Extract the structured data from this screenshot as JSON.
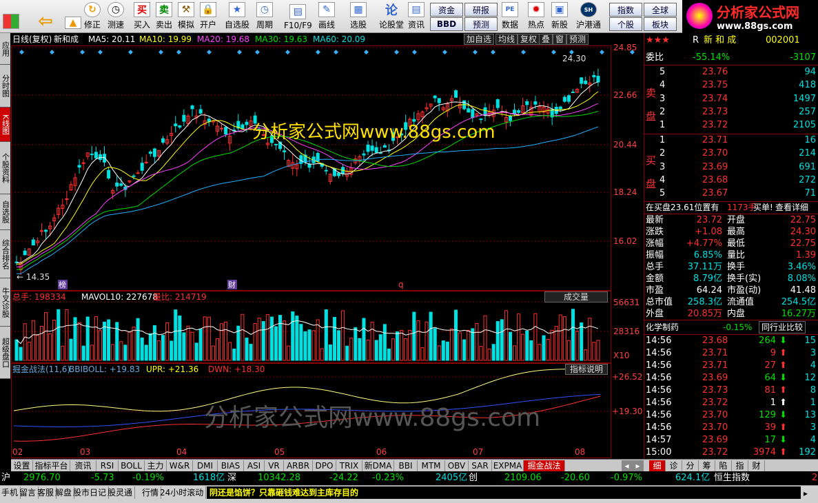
{
  "toolbar": {
    "buttons": [
      {
        "label": ""
      },
      {
        "label": ""
      },
      {
        "label": "修正"
      },
      {
        "label": "测速"
      },
      {
        "label": "买入"
      },
      {
        "label": "卖出"
      },
      {
        "label": "模拟"
      },
      {
        "label": "开户"
      },
      {
        "label": "自选股"
      },
      {
        "label": "周期"
      },
      {
        "label": "F10/F9"
      },
      {
        "label": "画线"
      },
      {
        "label": "选股"
      },
      {
        "label": "论股堂"
      },
      {
        "label": "资讯"
      },
      {
        "label": "数据"
      },
      {
        "label": "热点"
      },
      {
        "label": "新股"
      },
      {
        "label": "沪港通"
      }
    ],
    "small_buttons": [
      "资金",
      "研报",
      "BBD",
      "预测",
      "指数",
      "全球",
      "个股",
      "板块"
    ],
    "logo_title": "分析家公式网",
    "logo_url": "www.88gs.com"
  },
  "left_tabs": [
    "应用",
    "分时图",
    "K线图",
    "个股资料",
    "自选股",
    "综合排名",
    "牛叉诊股",
    "超级盘口"
  ],
  "info_bar": {
    "mode": "日线(复权)",
    "stock_name": "新和成",
    "ma5": "MA5: 20.11",
    "ma10": "MA10: 19.99",
    "ma20": "MA20: 19.68",
    "ma30": "MA30: 19.63",
    "ma60": "MA60: 20.09",
    "buttons": [
      "加自选",
      "均线",
      "复权",
      "叠",
      "窗",
      "预测"
    ]
  },
  "price_axis": [
    "24.85",
    "22.66",
    "20.44",
    "18.24",
    "16.02"
  ],
  "price_labels": {
    "high": "24.30",
    "low": "14.35"
  },
  "markers": [
    "榜",
    "财",
    "q"
  ],
  "watermark_top": "分析家公式网www.88gs.com",
  "watermark_bottom": "分析家公式网www.88gs.com",
  "volume_bar": {
    "total": "总手: 198334",
    "mavol": "MAVOL10: 227678",
    "ratio": "量比: 214719",
    "selector": "成交量",
    "axis": [
      "56631",
      "28316",
      "X10"
    ]
  },
  "indicator_bar": {
    "name": "掘金战法(11,6)",
    "bbiboll": "BBIBOLL: +19.83",
    "upr": "UPR: +21.36",
    "dwn": "DWN: +18.30",
    "help": "指标说明",
    "axis": [
      "+26.52",
      "+19.30"
    ]
  },
  "x_axis": [
    "02",
    "03",
    "04",
    "05",
    "06",
    "07",
    "08"
  ],
  "right_panel": {
    "header": {
      "stars": "★★★",
      "name": "新 和 成",
      "code": "002001",
      "prefix": "R"
    },
    "weibi": {
      "label": "委比",
      "pct": "-55.14%",
      "diff": "-3107"
    },
    "sell_label": "卖盘",
    "buy_label": "买盘",
    "sell": [
      {
        "n": "5",
        "p": "23.76",
        "v": "94"
      },
      {
        "n": "4",
        "p": "23.75",
        "v": "418"
      },
      {
        "n": "3",
        "p": "23.74",
        "v": "1497"
      },
      {
        "n": "2",
        "p": "23.73",
        "v": "257"
      },
      {
        "n": "1",
        "p": "23.72",
        "v": "2105"
      }
    ],
    "buy": [
      {
        "n": "1",
        "p": "23.71",
        "v": "16"
      },
      {
        "n": "2",
        "p": "23.70",
        "v": "214"
      },
      {
        "n": "3",
        "p": "23.69",
        "v": "691"
      },
      {
        "n": "4",
        "p": "23.68",
        "v": "272"
      },
      {
        "n": "5",
        "p": "23.67",
        "v": "71"
      }
    ],
    "position_line": {
      "text": "在买盘23.61位置有",
      "vol": "1173手",
      "buy": "买单!",
      "detail": "查看详细"
    },
    "stats": [
      {
        "l1": "最新",
        "v1": "23.72",
        "l2": "开盘",
        "v2": "22.75"
      },
      {
        "l1": "涨跌",
        "v1": "+1.08",
        "l2": "最高",
        "v2": "24.30"
      },
      {
        "l1": "涨幅",
        "v1": "+4.77%",
        "l2": "最低",
        "v2": "22.75"
      },
      {
        "l1": "振幅",
        "v1": "6.85%",
        "l2": "量比",
        "v2": "1.39"
      },
      {
        "l1": "总手",
        "v1": "37.11万",
        "l2": "换手",
        "v2": "3.46%"
      },
      {
        "l1": "金额",
        "v1": "8.79亿",
        "l2": "换手(实)",
        "v2": "8.08%"
      },
      {
        "l1": "市盈",
        "v1": "64.24",
        "l2": "市盈(动)",
        "v2": "41.48"
      },
      {
        "l1": "总市值",
        "v1": "258.3亿",
        "l2": "流通值",
        "v2": "254.5亿"
      },
      {
        "l1": "外盘",
        "v1": "20.85万",
        "l2": "内盘",
        "v2": "16.27万"
      }
    ],
    "industry": {
      "name": "化学制药",
      "pct": "-0.15%",
      "compare": "同行业比较"
    },
    "ticks": [
      {
        "t": "14:56",
        "p": "23.68",
        "v": "264",
        "d": "down",
        "n": "15"
      },
      {
        "t": "14:56",
        "p": "23.71",
        "v": "9",
        "d": "up",
        "n": "3"
      },
      {
        "t": "14:56",
        "p": "23.71",
        "v": "27",
        "d": "up",
        "n": "4"
      },
      {
        "t": "14:56",
        "p": "23.69",
        "v": "64",
        "d": "down",
        "n": "12"
      },
      {
        "t": "14:56",
        "p": "23.73",
        "v": "81",
        "d": "up",
        "n": "8"
      },
      {
        "t": "14:56",
        "p": "23.72",
        "v": "1",
        "d": "flat",
        "n": "1"
      },
      {
        "t": "14:56",
        "p": "23.70",
        "v": "129",
        "d": "down",
        "n": "13"
      },
      {
        "t": "14:56",
        "p": "23.70",
        "v": "39",
        "d": "up",
        "n": "3"
      },
      {
        "t": "14:57",
        "p": "23.69",
        "v": "17",
        "d": "down",
        "n": "4"
      },
      {
        "t": "15:00",
        "p": "23.72",
        "v": "3974",
        "d": "up",
        "n": "192"
      }
    ],
    "bottom_tabs": [
      "细",
      "诊",
      "分",
      "筹",
      "陷",
      "指",
      "财"
    ]
  },
  "bottom_tabs": [
    "设置",
    "指标平台",
    "资讯",
    "RSI",
    "BOLL",
    "主力",
    "W&R",
    "DMI",
    "BIAS",
    "ASI",
    "VR",
    "ARBR",
    "DPO",
    "TRIX",
    "新DMA",
    "BBI",
    "MTM",
    "OBV",
    "SAR",
    "EXPMA",
    "掘金战法"
  ],
  "status_bar": {
    "sh_label": "沪",
    "sh_index": "2976.70",
    "sh_chg": "-5.73",
    "sh_pct": "-0.19%",
    "sh_amt": "1618亿",
    "sz_label": "深",
    "sz_index": "10342.28",
    "sz_chg": "-24.22",
    "sz_pct": "-0.23%",
    "sz_amt": "2405亿",
    "cy_label": "创",
    "cy_index": "2109.06",
    "cy_chg": "-20.60",
    "cy_pct": "-0.97%",
    "cy_amt": "624.1亿",
    "hs_label": "恒生指数",
    "hs_val": "2"
  },
  "taskbar": {
    "items": [
      "手机",
      "留言",
      "客服",
      "解盘",
      "股市日记",
      "股灵通",
      "行情",
      "24小时滚动"
    ],
    "news": "阴还是馅饼？只靠砸钱难达到主库存目的"
  }
}
